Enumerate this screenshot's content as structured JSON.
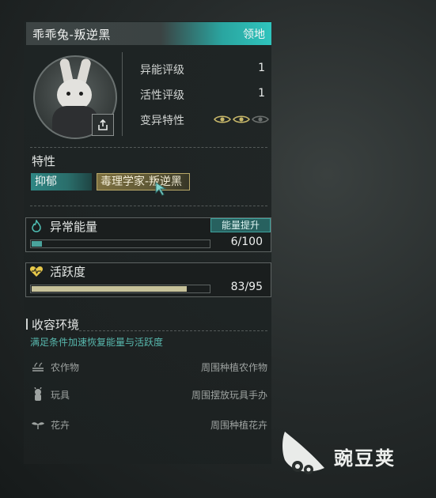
{
  "header": {
    "title": "乖乖兔-叛逆黑",
    "badge": "领地"
  },
  "stats": [
    {
      "label": "异能评级",
      "value": "1"
    },
    {
      "label": "活性评级",
      "value": "1"
    },
    {
      "label": "变异特性",
      "value": ""
    }
  ],
  "mutation_eyes": {
    "active": 2,
    "total": 3,
    "active_color": "#c8b86a",
    "inactive_color": "#6c706e"
  },
  "traits": {
    "label": "特性",
    "items": [
      "抑郁",
      "毒理学家-叛逆黑"
    ]
  },
  "energy": {
    "title": "异常能量",
    "boost_label": "能量提升",
    "value_text": "6/100",
    "fraction": 0.06,
    "color": "#4aa39c"
  },
  "activity": {
    "title": "活跃度",
    "value_text": "83/95",
    "fraction": 0.8737,
    "color": "#c7c29a"
  },
  "environment": {
    "title": "收容环境",
    "description": "满足条件加速恢复能量与活跃度",
    "rows": [
      {
        "icon": "crop-icon",
        "name": "农作物",
        "requirement": "周围种植农作物"
      },
      {
        "icon": "toy-icon",
        "name": "玩具",
        "requirement": "周围摆放玩具手办"
      },
      {
        "icon": "flower-icon",
        "name": "花卉",
        "requirement": "周围种植花卉"
      }
    ]
  },
  "watermark": {
    "text": "豌豆荚"
  }
}
